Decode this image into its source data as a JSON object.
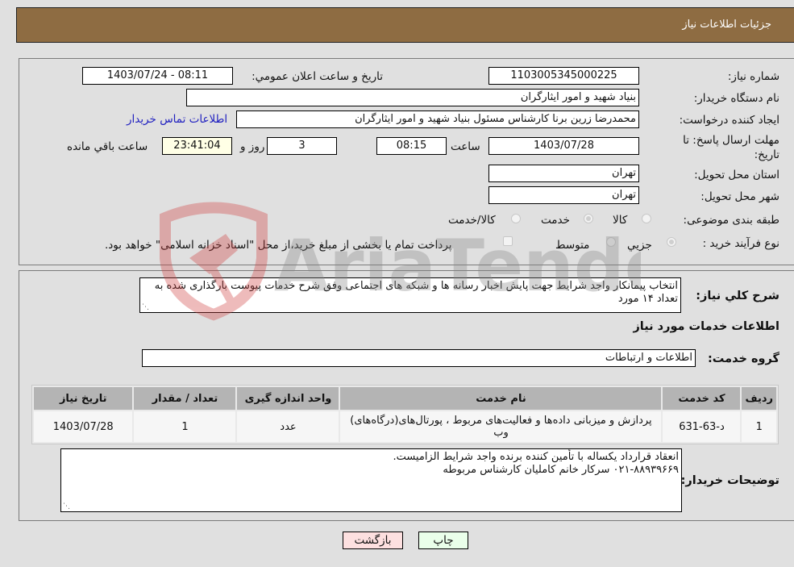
{
  "header": {
    "title": "جزئیات اطلاعات نیاز"
  },
  "form": {
    "need_number": {
      "label": "شماره نیاز:",
      "value": "1103005345000225"
    },
    "announce_datetime": {
      "label": "تاريخ و ساعت اعلان عمومي:",
      "value": "1403/07/24 - 08:11"
    },
    "buyer_org": {
      "label": "نام دستگاه خريدار:",
      "value": "بنياد شهيد و امور ايثارگران"
    },
    "requester": {
      "label": "ايجاد كننده درخواست:",
      "value": "محمدرضا زرين برنا كارشناس مسئول  بنياد شهيد و امور ايثارگران"
    },
    "buyer_contact_link": "اطلاعات تماس خريدار",
    "deadline": {
      "label": "مهلت ارسال پاسخ: تا تاريخ:",
      "date": "1403/07/28",
      "time_label": "ساعت",
      "time": "08:15",
      "days": "3",
      "days_label": "روز و",
      "remaining": "23:41:04",
      "remaining_label": "ساعت باقي مانده"
    },
    "province": {
      "label": "استان محل تحويل:",
      "value": "تهران"
    },
    "city": {
      "label": "شهر محل تحويل:",
      "value": "تهران"
    },
    "category": {
      "label": "طبقه بندی موضوعی:",
      "options": [
        "کالا",
        "خدمت",
        "کالا/خدمت"
      ],
      "selected": "خدمت"
    },
    "purchase_type": {
      "label": "نوع فرآيند خريد :",
      "options": [
        "جزيي",
        "متوسط"
      ],
      "selected": "جزيي",
      "treasury_note": "پرداخت تمام يا بخشی از مبلغ خريد،از محل \"اسناد خزانه اسلامی\" خواهد بود."
    }
  },
  "description": {
    "label": "شرح كلي نياز:",
    "value": "انتخاب پیمانکار واجد شرایط جهت پایش اخبار رسانه ها و شبکه های اجتماعی وفق شرح خدمات پیوست بارگذاری شده به تعداد ۱۴ مورد"
  },
  "services_section": {
    "title": "اطلاعات خدمات مورد نياز",
    "group_label": "گروه خدمت:",
    "group_value": "اطلاعات و ارتباطات",
    "table": {
      "headers": [
        "رديف",
        "كد خدمت",
        "نام خدمت",
        "واحد اندازه گيری",
        "تعداد / مقدار",
        "تاريخ نياز"
      ],
      "rows": [
        [
          "1",
          "د-63-631",
          "پردازش و میزبانی داده‌ها و فعالیت‌های مربوط ، پورتال‌های(درگاه‌های) وب",
          "عدد",
          "1",
          "1403/07/28"
        ]
      ]
    }
  },
  "buyer_notes": {
    "label": "توضيحات خريدار:",
    "lines": [
      "انعقاد قرارداد یکساله با تأمین کننده برنده واجد شرایط الزامیست.",
      "۰۲۱-۸۸۹۳۹۶۶۹ سرکار خانم کاملیان کارشناس مربوطه"
    ]
  },
  "buttons": {
    "print": "چاپ",
    "back": "بازگشت"
  },
  "watermark": {
    "text": "AriaTender.neT"
  }
}
